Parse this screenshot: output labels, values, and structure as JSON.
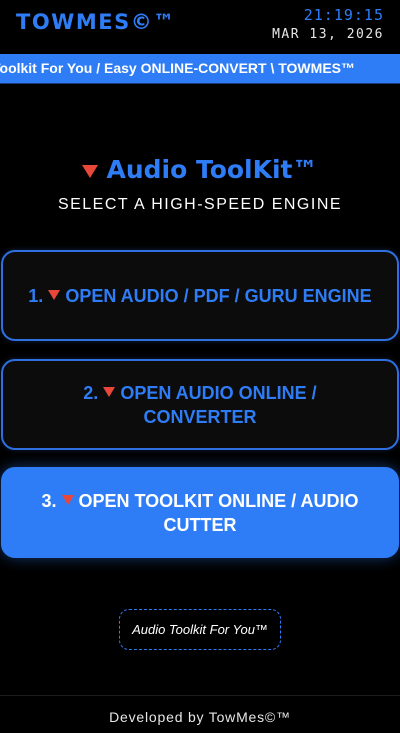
{
  "header": {
    "brand": "TOWMES©™",
    "time": "21:19:15",
    "date": "MAR 13, 2026"
  },
  "marquee": {
    "text": "Toolkit For You / Easy ONLINE-CONVERT \\ TOWMES™"
  },
  "hero": {
    "title": "Audio ToolKit™",
    "subtitle": "SELECT A HIGH-SPEED ENGINE"
  },
  "engines": [
    {
      "number": "1.",
      "label": "OPEN AUDIO / PDF / GURU ENGINE"
    },
    {
      "number": "2.",
      "label": "OPEN AUDIO ONLINE / CONVERTER"
    },
    {
      "number": "3.",
      "label": "OPEN TOOLKIT ONLINE / AUDIO CUTTER"
    }
  ],
  "badge": {
    "text": "Audio Toolkit For You™"
  },
  "footer": {
    "text": "Developed by TowMes©™"
  },
  "colors": {
    "accent": "#2f7df6",
    "triangle": "#e8473a",
    "background": "#000000"
  },
  "icons": {
    "marker": "red-triangle-down-icon"
  }
}
